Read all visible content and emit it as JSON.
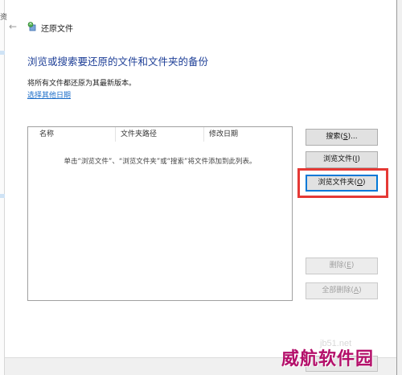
{
  "window": {
    "title": "还原文件"
  },
  "main": {
    "heading": "浏览或搜索要还原的文件和文件夹的备份",
    "description": "将所有文件都还原为其最新版本。",
    "choose_date_link": "选择其他日期"
  },
  "file_list": {
    "columns": [
      "名称",
      "文件夹路径",
      "修改日期"
    ],
    "empty_hint": "单击“浏览文件”、“浏览文件夹”或“搜索”将文件添加到此列表。"
  },
  "buttons": {
    "search": {
      "label": "搜索(",
      "key": "S",
      "tail": ")..."
    },
    "browse_files": {
      "label": "浏览文件(",
      "key": "I",
      "tail": ")"
    },
    "browse_folders": {
      "label": "浏览文件夹(",
      "key": "O",
      "tail": ")"
    },
    "remove": {
      "label": "删除(",
      "key": "E",
      "tail": ")"
    },
    "remove_all": {
      "label": "全部删除(",
      "key": "A",
      "tail": ")"
    }
  },
  "watermark": {
    "site": "jb51.net",
    "brand": "威航软件园"
  },
  "colors": {
    "heading": "#1e3f97",
    "link": "#1a6cc8",
    "highlight": "#e53935",
    "focus": "#0078d7",
    "watermark": "#b40f6a"
  },
  "icons": {
    "back": "back-arrow-icon",
    "app": "restore-files-icon"
  }
}
